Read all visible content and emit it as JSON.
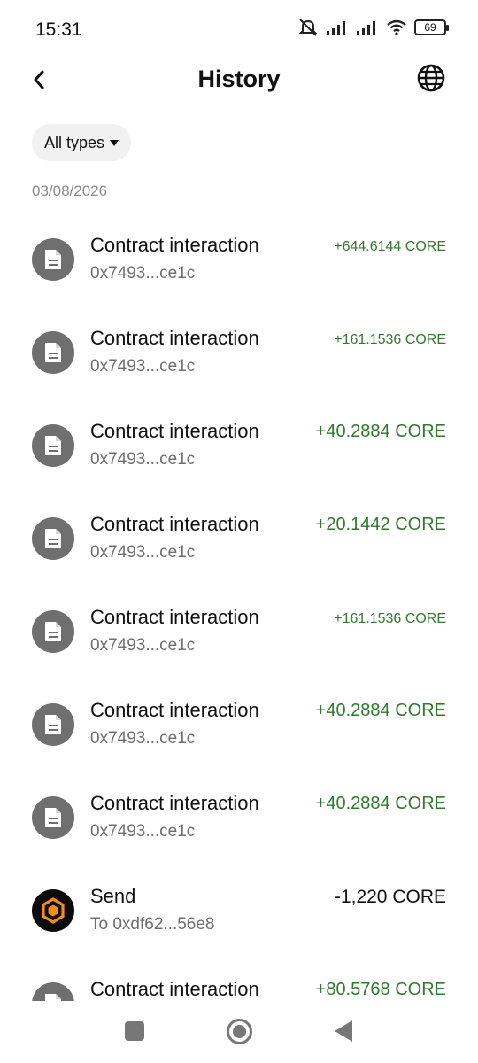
{
  "status_bar": {
    "time": "15:31",
    "battery": "69",
    "icons": [
      "mute-icon",
      "signal-icon",
      "signal-icon",
      "wifi-icon",
      "battery-icon"
    ]
  },
  "header": {
    "title": "History",
    "back_icon": "chevron-left-icon",
    "globe_icon": "globe-icon"
  },
  "filter": {
    "label": "All types",
    "icon": "caret-down-icon"
  },
  "date_group": "03/08/2026",
  "colors": {
    "positive": "#2f7a2c",
    "icon_bg": "#6f6f6f",
    "send_icon_accent": "#f28c1b"
  },
  "transactions": [
    {
      "title": "Contract interaction",
      "subtitle": "0x7493...ce1c",
      "amount": "+644.6144 CORE",
      "type": "contract"
    },
    {
      "title": "Contract interaction",
      "subtitle": "0x7493...ce1c",
      "amount": "+161.1536 CORE",
      "type": "contract"
    },
    {
      "title": "Contract interaction",
      "subtitle": "0x7493...ce1c",
      "amount": "+40.2884 CORE",
      "type": "contract"
    },
    {
      "title": "Contract interaction",
      "subtitle": "0x7493...ce1c",
      "amount": "+20.1442 CORE",
      "type": "contract"
    },
    {
      "title": "Contract interaction",
      "subtitle": "0x7493...ce1c",
      "amount": "+161.1536 CORE",
      "type": "contract"
    },
    {
      "title": "Contract interaction",
      "subtitle": "0x7493...ce1c",
      "amount": "+40.2884 CORE",
      "type": "contract"
    },
    {
      "title": "Contract interaction",
      "subtitle": "0x7493...ce1c",
      "amount": "+40.2884 CORE",
      "type": "contract"
    },
    {
      "title": "Send",
      "subtitle": "To 0xdf62...56e8",
      "amount": "-1,220 CORE",
      "type": "send"
    },
    {
      "title": "Contract interaction",
      "subtitle": "",
      "amount": "+80.5768 CORE",
      "type": "contract"
    }
  ],
  "nav_bar": {
    "icons": [
      "recent-apps-icon",
      "home-icon",
      "back-icon"
    ]
  }
}
